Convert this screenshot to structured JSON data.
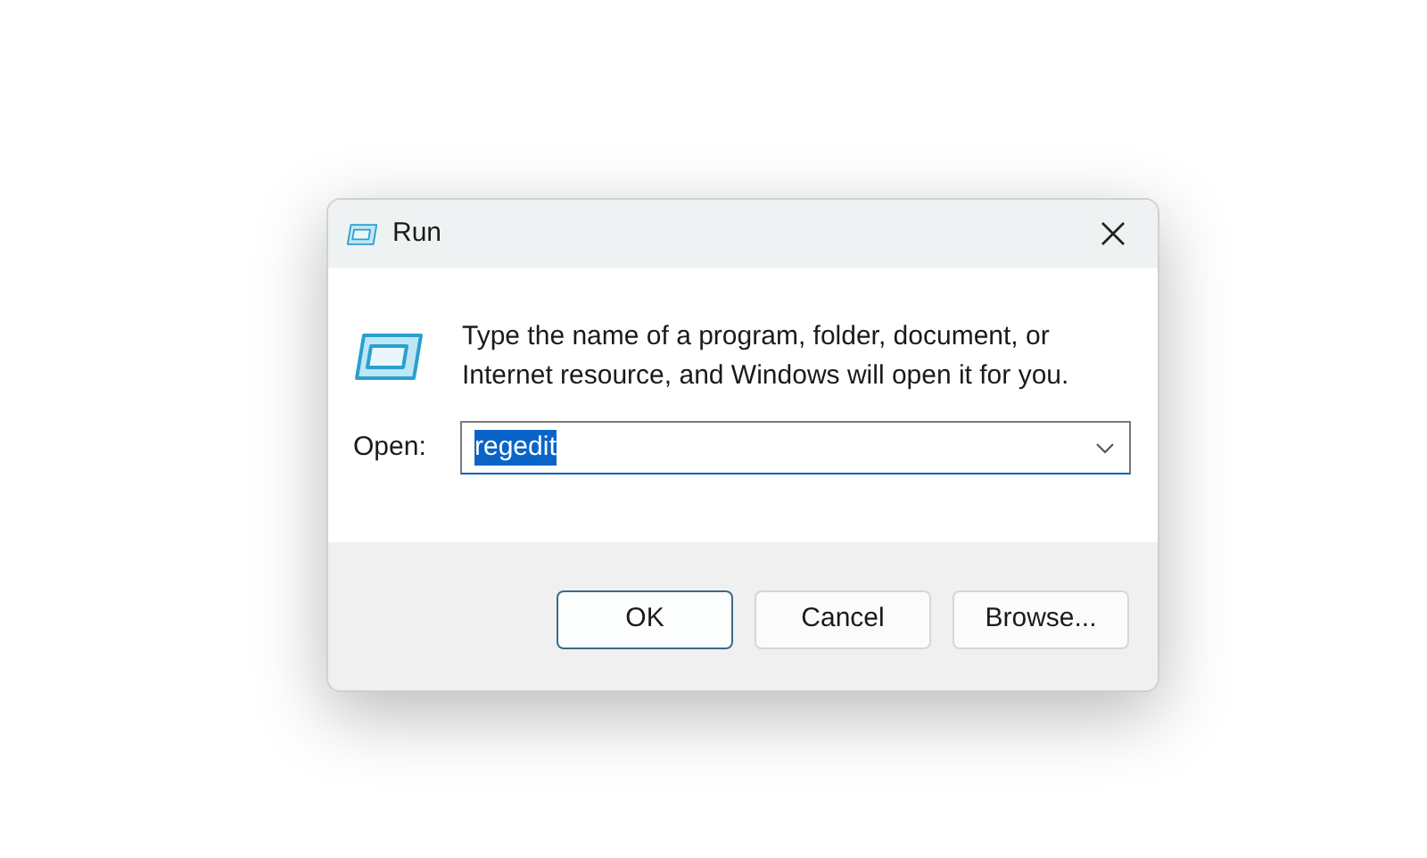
{
  "window": {
    "title": "Run"
  },
  "message": "Type the name of a program, folder, document, or Internet resource, and Windows will open it for you.",
  "open_field": {
    "label": "Open:",
    "value": "regedit",
    "text_selected": true
  },
  "buttons": [
    {
      "label": "OK",
      "default": true
    },
    {
      "label": "Cancel",
      "default": false
    },
    {
      "label": "Browse...",
      "default": false
    }
  ]
}
